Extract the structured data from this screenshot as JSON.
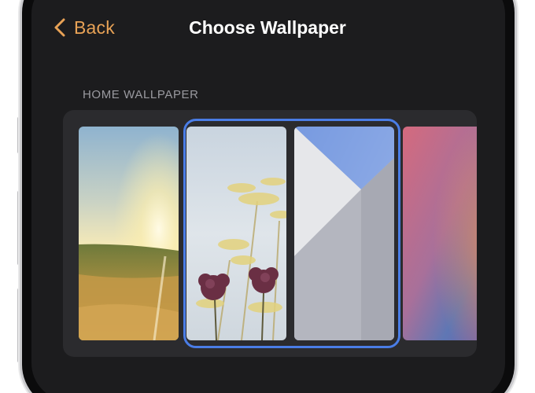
{
  "nav": {
    "back_label": "Back",
    "title": "Choose Wallpaper"
  },
  "section": {
    "label": "HOME WALLPAPER"
  },
  "colors": {
    "accent": "#e8a256",
    "selection": "#4a7de6",
    "background": "#1c1c1e",
    "panel": "#2b2b2e"
  },
  "icons": {
    "back": "chevron-left-icon"
  },
  "wallpapers": [
    {
      "id": "sunset-field",
      "selected": false
    },
    {
      "id": "flowers-sky",
      "selected": true
    },
    {
      "id": "white-wall-sky",
      "selected": true
    },
    {
      "id": "gradient-pink-blue",
      "selected": false
    }
  ]
}
